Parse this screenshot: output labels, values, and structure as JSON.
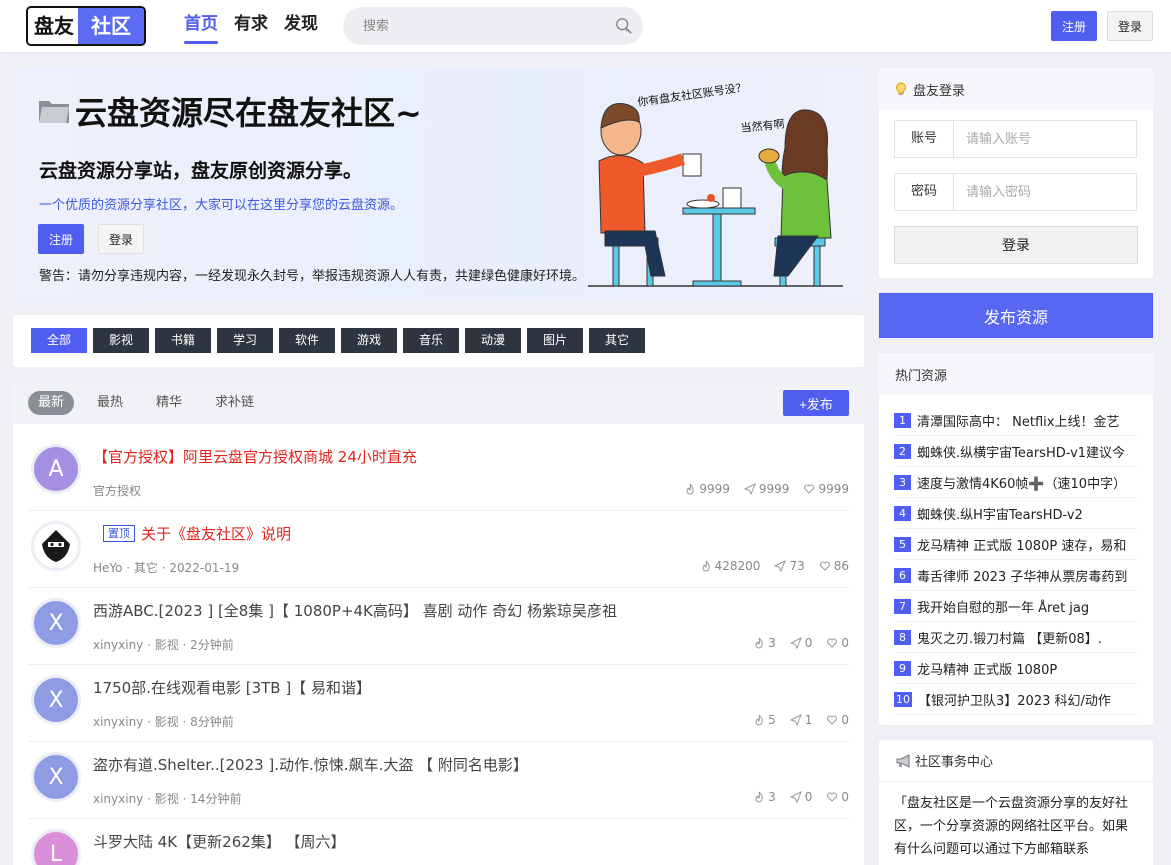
{
  "header": {
    "logo_left": "盘友",
    "logo_right": "社区",
    "nav": [
      "首页",
      "有求",
      "发现"
    ],
    "search_placeholder": "搜索",
    "register_label": "注册",
    "login_label": "登录"
  },
  "hero": {
    "title": "云盘资源尽在盘友社区~",
    "subtitle": "云盘资源分享站，盘友原创资源分享。",
    "description": "一个优质的资源分享社区，大家可以在这里分享您的云盘资源。",
    "register_label": "注册",
    "login_label": "登录",
    "warning": "警告：请勿分享违规内容，一经发现永久封号，举报违规资源人人有责，共建绿色健康好环境。",
    "speech_1": "你有盘友社区账号没？",
    "speech_2": "当然有啊"
  },
  "categories": [
    "全部",
    "影视",
    "书籍",
    "学习",
    "软件",
    "游戏",
    "音乐",
    "动漫",
    "图片",
    "其它"
  ],
  "list": {
    "tabs": [
      "最新",
      "最热",
      "精华",
      "求补链"
    ],
    "publish_label": "+发布",
    "pin_label": "置顶",
    "rows": [
      {
        "avatar": "A",
        "title": "【官方授权】阿里云盘官方授权商城 24小时直充",
        "meta": "官方授权",
        "views": "9999",
        "shares": "9999",
        "likes": "9999"
      },
      {
        "avatar": "",
        "title": "关于《盘友社区》说明",
        "meta": "HeYo · 其它 · 2022-01-19",
        "views": "428200",
        "shares": "73",
        "likes": "86"
      },
      {
        "avatar": "X",
        "title": "西游ABC.[2023 ] [全8集 ]【 1080P+4K高码】 喜剧 动作 奇幻 杨紫琼吴彦祖",
        "meta": "xinyxiny · 影视 · 2分钟前",
        "views": "3",
        "shares": "0",
        "likes": "0"
      },
      {
        "avatar": "X",
        "title": "1750部.在线观看电影 [3TB ]【 易和谐】",
        "meta": "xinyxiny · 影视 · 8分钟前",
        "views": "5",
        "shares": "1",
        "likes": "0"
      },
      {
        "avatar": "X",
        "title": "盗亦有道.Shelter..[2023 ].动作.惊悚.飙车.大盗 【 附同名电影】",
        "meta": "xinyxiny · 影视 · 14分钟前",
        "views": "3",
        "shares": "0",
        "likes": "0"
      },
      {
        "avatar": "L",
        "title": "斗罗大陆 4K【更新262集】 【周六】",
        "meta": "",
        "views": "",
        "shares": "",
        "likes": ""
      }
    ]
  },
  "login_card": {
    "title": "盘友登录",
    "account_label": "账号",
    "account_placeholder": "请输入账号",
    "password_label": "密码",
    "password_placeholder": "请输入密码",
    "login_button": "登录"
  },
  "publish_button": "发布资源",
  "hot": {
    "title": "热门资源",
    "items": [
      "清潭国际高中： Netflix上线！金艺",
      "蜘蛛侠.纵横宇宙TearsHD-v1建议今",
      "速度与激情4K60帧➕（速10中字）",
      "蜘蛛侠.纵H宇宙TearsHD-v2",
      "龙马精神 正式版 1080P 速存，易和",
      "毒舌律师 2023 子华神从票房毒药到",
      "我开始自慰的那一年 Året jag",
      "鬼灭之刃.锻刀村篇 【更新08】.",
      "龙马精神 正式版 1080P",
      "【银河护卫队3】2023 科幻/动作"
    ]
  },
  "notice": {
    "title": "社区事务中心",
    "body": "「盘友社区是一个云盘资源分享的友好社区，一个分享资源的网络社区平台。如果有什么问题可以通过下方邮箱联系"
  },
  "colors": {
    "accent": "#4f5ef0",
    "dark_tag": "#2f3540",
    "red_title": "#e0241e"
  }
}
